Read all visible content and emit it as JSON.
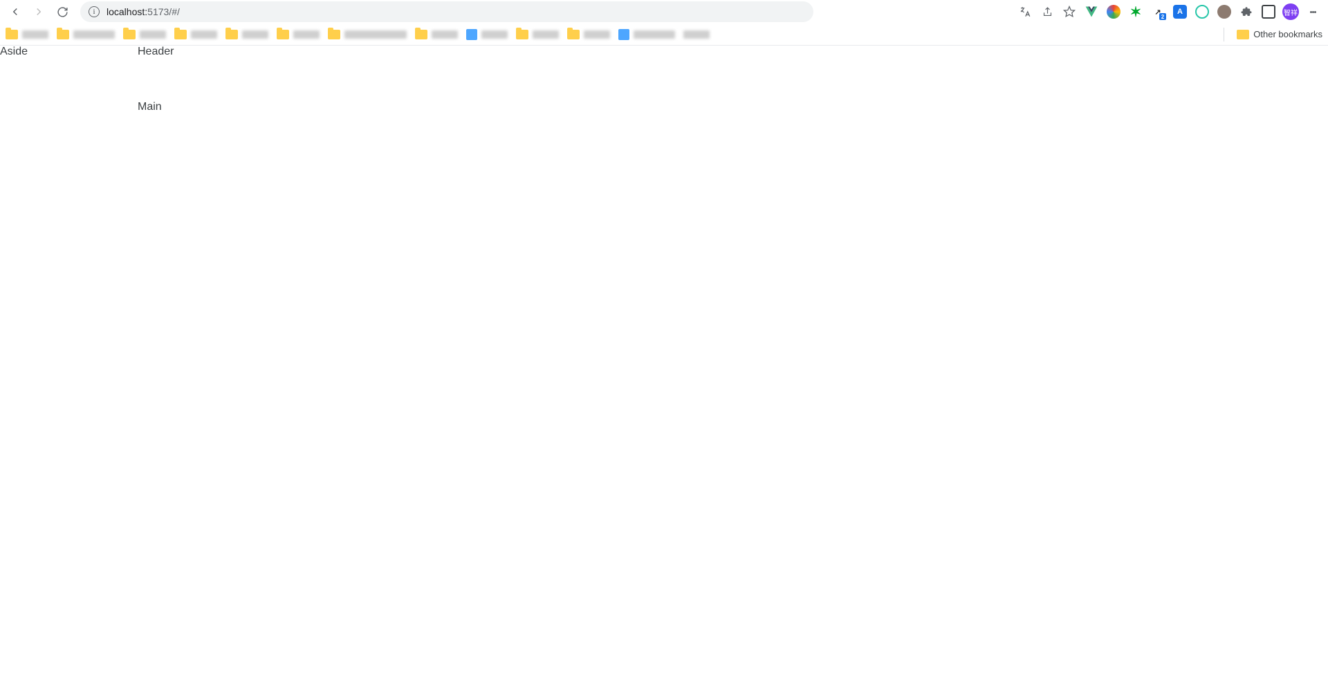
{
  "browser": {
    "url_host": "localhost:",
    "url_port_path": "5173/#/",
    "other_bookmarks_label": "Other bookmarks",
    "avatar_text": "智祥"
  },
  "page": {
    "aside_label": "Aside",
    "header_label": "Header",
    "main_label": "Main"
  }
}
